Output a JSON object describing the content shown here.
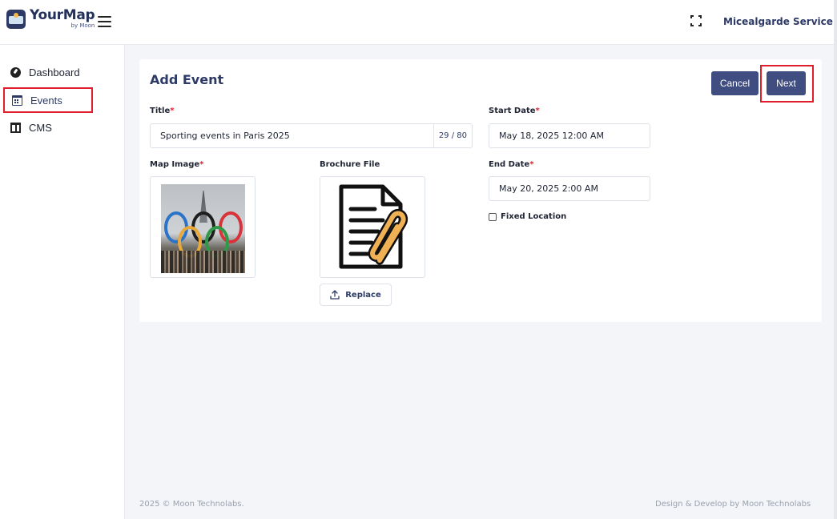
{
  "app": {
    "logo_title": "YourMap",
    "logo_subtitle": "by Moon",
    "user_name": "Micealgarde Service"
  },
  "sidebar": {
    "items": [
      {
        "label": "Dashboard",
        "icon": "dashboard-icon"
      },
      {
        "label": "Events",
        "icon": "calendar-icon",
        "active": true
      },
      {
        "label": "CMS",
        "icon": "cms-icon"
      }
    ]
  },
  "form": {
    "title": "Add Event",
    "cancel_label": "Cancel",
    "next_label": "Next",
    "title_label": "Title",
    "title_value": "Sporting events in Paris 2025",
    "title_counter": "29 / 80",
    "start_date_label": "Start Date",
    "start_date_value": "May 18, 2025 12:00 AM",
    "end_date_label": "End Date",
    "end_date_value": "May 20, 2025 2:00 AM",
    "map_image_label": "Map Image",
    "brochure_label": "Brochure File",
    "replace_label": "Replace",
    "fixed_location_label": "Fixed Location",
    "fixed_location_checked": false,
    "required_mark": "*"
  },
  "footer": {
    "copyright": "2025 © Moon Technolabs.",
    "credit": "Design & Develop by Moon Technolabs"
  },
  "colors": {
    "primary": "#3f4d80",
    "highlight": "#e01e2b",
    "required": "#e01e2b"
  }
}
